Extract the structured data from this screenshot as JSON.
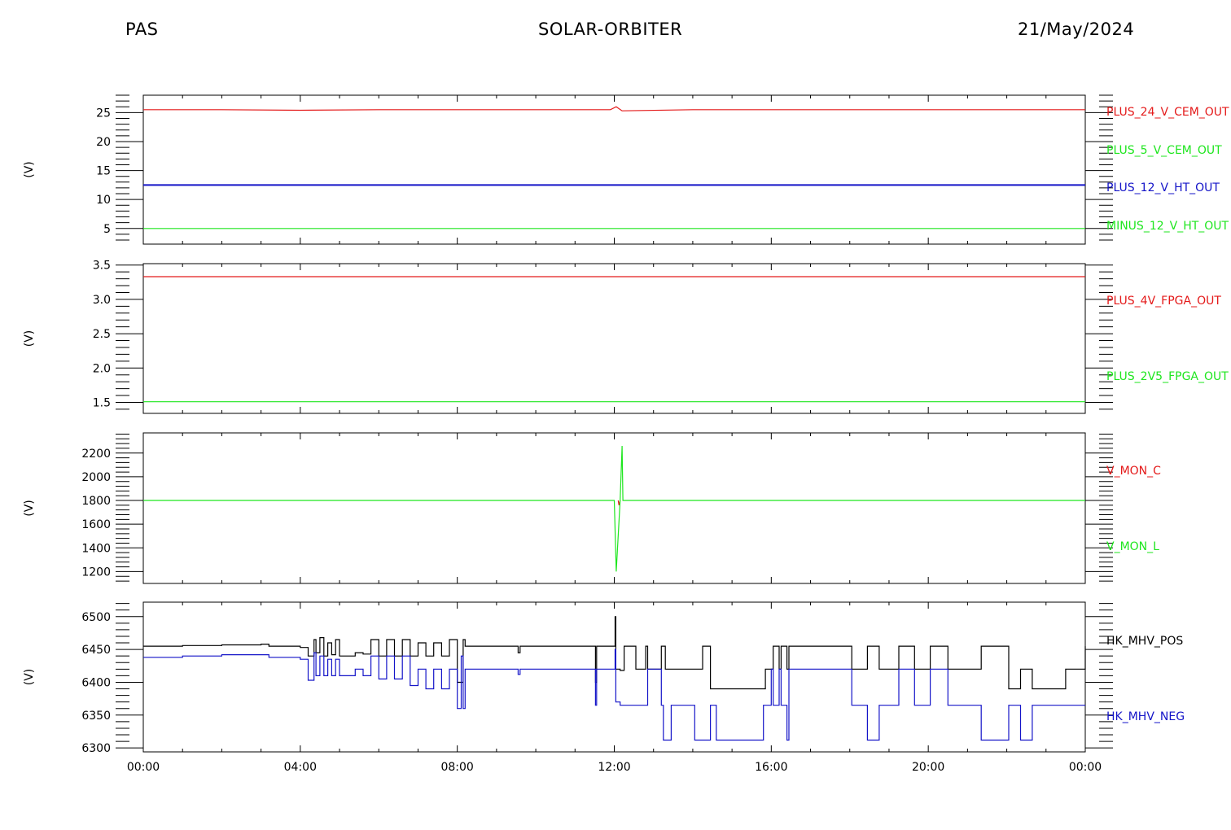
{
  "header": {
    "left": "PAS",
    "center": "SOLAR-ORBITER",
    "right": "21/May/2024"
  },
  "colors": {
    "red": "#e41a1a",
    "green": "#1ee61e",
    "blue": "#1414c8",
    "black": "#000000"
  },
  "chart_data": [
    {
      "type": "line",
      "ylabel": "(V)",
      "ylim": [
        2.3,
        28
      ],
      "yticks": [
        5,
        10,
        15,
        20,
        25
      ],
      "ytick_labels": [
        "5",
        "10",
        "15",
        "20",
        "25"
      ],
      "series": [
        {
          "name": "PLUS_24_V_CEM_OUT",
          "color": "#e41a1a",
          "x": [
            0,
            2,
            4,
            6,
            8,
            10,
            11.9,
            12.05,
            12.2,
            14,
            18,
            22,
            24
          ],
          "y": [
            25.5,
            25.5,
            25.4,
            25.5,
            25.5,
            25.5,
            25.5,
            26.0,
            25.3,
            25.5,
            25.5,
            25.5,
            25.5
          ]
        },
        {
          "name": "PLUS_5_V_CEM_OUT",
          "color": "#1ee61e",
          "x": [],
          "y": []
        },
        {
          "name": "PLUS_12_V_HT_OUT",
          "color": "#1414c8",
          "x": [
            0,
            24
          ],
          "y": [
            12.5,
            12.5
          ]
        },
        {
          "name": "MINUS_12_V_HT_OUT",
          "color": "#1ee61e",
          "x": [
            0,
            24
          ],
          "y": [
            5.0,
            5.0
          ]
        }
      ]
    },
    {
      "type": "line",
      "ylabel": "(V)",
      "ylim": [
        1.34,
        3.52
      ],
      "yticks": [
        1.5,
        2.0,
        2.5,
        3.0,
        3.5
      ],
      "ytick_labels": [
        "1.5",
        "2.0",
        "2.5",
        "3.0",
        "3.5"
      ],
      "series": [
        {
          "name": "PLUS_4V_FPGA_OUT",
          "color": "#e41a1a",
          "x": [
            0,
            24
          ],
          "y": [
            3.33,
            3.33
          ]
        },
        {
          "name": "PLUS_2V5_FPGA_OUT",
          "color": "#1ee61e",
          "x": [
            0,
            24
          ],
          "y": [
            1.51,
            1.51
          ]
        }
      ]
    },
    {
      "type": "line",
      "ylabel": "(V)",
      "ylim": [
        1100,
        2370
      ],
      "yticks": [
        1200,
        1400,
        1600,
        1800,
        2000,
        2200
      ],
      "ytick_labels": [
        "1200",
        "1400",
        "1600",
        "1800",
        "2000",
        "2200"
      ],
      "series": [
        {
          "name": "V_MON_C",
          "color": "#e41a1a",
          "x": [
            12.1,
            12.12,
            12.15
          ],
          "y": [
            1800,
            1760,
            1800
          ]
        },
        {
          "name": "V_MON_L",
          "color": "#1ee61e",
          "x": [
            0,
            12.0,
            12.05,
            12.15,
            12.2,
            12.22,
            24
          ],
          "y": [
            1800,
            1800,
            1200,
            1800,
            2260,
            1800,
            1800
          ]
        }
      ]
    },
    {
      "type": "line",
      "ylabel": "(V)",
      "ylim": [
        6294,
        6522
      ],
      "yticks": [
        6300,
        6350,
        6400,
        6450,
        6500
      ],
      "ytick_labels": [
        "6300",
        "6350",
        "6400",
        "6450",
        "6500"
      ],
      "x_tick_labels": [
        "00:00",
        "04:00",
        "08:00",
        "12:00",
        "16:00",
        "20:00",
        "00:00"
      ],
      "series": [
        {
          "name": "HK_MHV_POS",
          "color": "#000000",
          "x": [
            0,
            1,
            2,
            3,
            3.2,
            4,
            4.2,
            4.35,
            4.4,
            4.5,
            4.6,
            4.7,
            4.8,
            4.9,
            5.0,
            5.2,
            5.4,
            5.6,
            5.8,
            6.0,
            6.2,
            6.4,
            6.6,
            6.8,
            7.0,
            7.2,
            7.4,
            7.6,
            7.8,
            8.0,
            8.15,
            8.2,
            9.5,
            9.55,
            9.6,
            11.5,
            11.52,
            11.55,
            12.0,
            12.02,
            12.04,
            12.15,
            12.25,
            12.5,
            12.55,
            12.8,
            12.85,
            13.2,
            13.3,
            14.2,
            14.25,
            14.4,
            14.45,
            15,
            15.5,
            15.8,
            15.85,
            16.0,
            16.05,
            16.2,
            16.25,
            16.4,
            16.45,
            17,
            18.0,
            18.05,
            18.4,
            18.45,
            18.7,
            18.75,
            19.2,
            19.25,
            19.6,
            19.65,
            20.0,
            20.05,
            20.5,
            21,
            21.3,
            21.35,
            22.0,
            22.05,
            22.3,
            22.35,
            22.6,
            22.65,
            23,
            23.5,
            23.95,
            24
          ],
          "y": [
            6455,
            6456,
            6457,
            6458,
            6455,
            6453,
            6440,
            6465,
            6445,
            6468,
            6440,
            6460,
            6442,
            6465,
            6440,
            6440,
            6445,
            6443,
            6465,
            6440,
            6465,
            6440,
            6465,
            6440,
            6460,
            6440,
            6460,
            6440,
            6465,
            6400,
            6465,
            6455,
            6455,
            6445,
            6455,
            6455,
            6400,
            6455,
            6455,
            6500,
            6420,
            6418,
            6455,
            6455,
            6420,
            6455,
            6420,
            6455,
            6420,
            6420,
            6455,
            6455,
            6390,
            6390,
            6390,
            6390,
            6420,
            6420,
            6455,
            6420,
            6455,
            6420,
            6455,
            6455,
            6455,
            6420,
            6420,
            6455,
            6455,
            6420,
            6420,
            6455,
            6455,
            6420,
            6420,
            6455,
            6420,
            6420,
            6420,
            6455,
            6455,
            6390,
            6390,
            6420,
            6420,
            6390,
            6390,
            6420,
            6420,
            6455
          ]
        },
        {
          "name": "HK_MHV_NEG",
          "color": "#1414c8",
          "x": [
            0,
            1,
            2,
            3,
            3.2,
            4,
            4.2,
            4.35,
            4.4,
            4.5,
            4.6,
            4.7,
            4.8,
            4.9,
            5.0,
            5.2,
            5.4,
            5.6,
            5.8,
            6.0,
            6.2,
            6.4,
            6.6,
            6.8,
            7.0,
            7.2,
            7.4,
            7.6,
            7.8,
            8.0,
            8.1,
            8.15,
            8.2,
            9.5,
            9.55,
            9.6,
            11.5,
            11.52,
            11.55,
            12.0,
            12.02,
            12.04,
            12.15,
            12.2,
            12.8,
            12.85,
            13.2,
            13.25,
            13.4,
            13.45,
            14.0,
            14.05,
            14.4,
            14.45,
            14.6,
            14.65,
            15,
            15.5,
            15.8,
            15.85,
            16.0,
            16.05,
            16.2,
            16.25,
            16.4,
            16.45,
            17,
            18.0,
            18.05,
            18.4,
            18.45,
            18.7,
            18.75,
            19.2,
            19.25,
            19.6,
            19.65,
            20.0,
            20.05,
            20.5,
            21,
            21.3,
            21.35,
            22.0,
            22.05,
            22.3,
            22.35,
            22.6,
            22.65,
            23,
            23.5,
            23.95,
            24
          ],
          "y": [
            6438,
            6440,
            6442,
            6442,
            6438,
            6435,
            6403,
            6445,
            6410,
            6440,
            6410,
            6435,
            6410,
            6435,
            6410,
            6410,
            6420,
            6410,
            6440,
            6405,
            6440,
            6405,
            6440,
            6395,
            6420,
            6390,
            6420,
            6390,
            6420,
            6360,
            6440,
            6360,
            6420,
            6420,
            6412,
            6420,
            6420,
            6365,
            6420,
            6420,
            6450,
            6370,
            6365,
            6365,
            6365,
            6420,
            6365,
            6312,
            6312,
            6365,
            6365,
            6312,
            6312,
            6365,
            6312,
            6312,
            6312,
            6312,
            6365,
            6365,
            6420,
            6365,
            6420,
            6365,
            6312,
            6420,
            6420,
            6420,
            6365,
            6365,
            6312,
            6312,
            6365,
            6365,
            6420,
            6420,
            6365,
            6365,
            6420,
            6365,
            6365,
            6365,
            6312,
            6312,
            6365,
            6365,
            6312,
            6312,
            6365,
            6365,
            6365,
            6365,
            6365
          ]
        }
      ]
    }
  ]
}
